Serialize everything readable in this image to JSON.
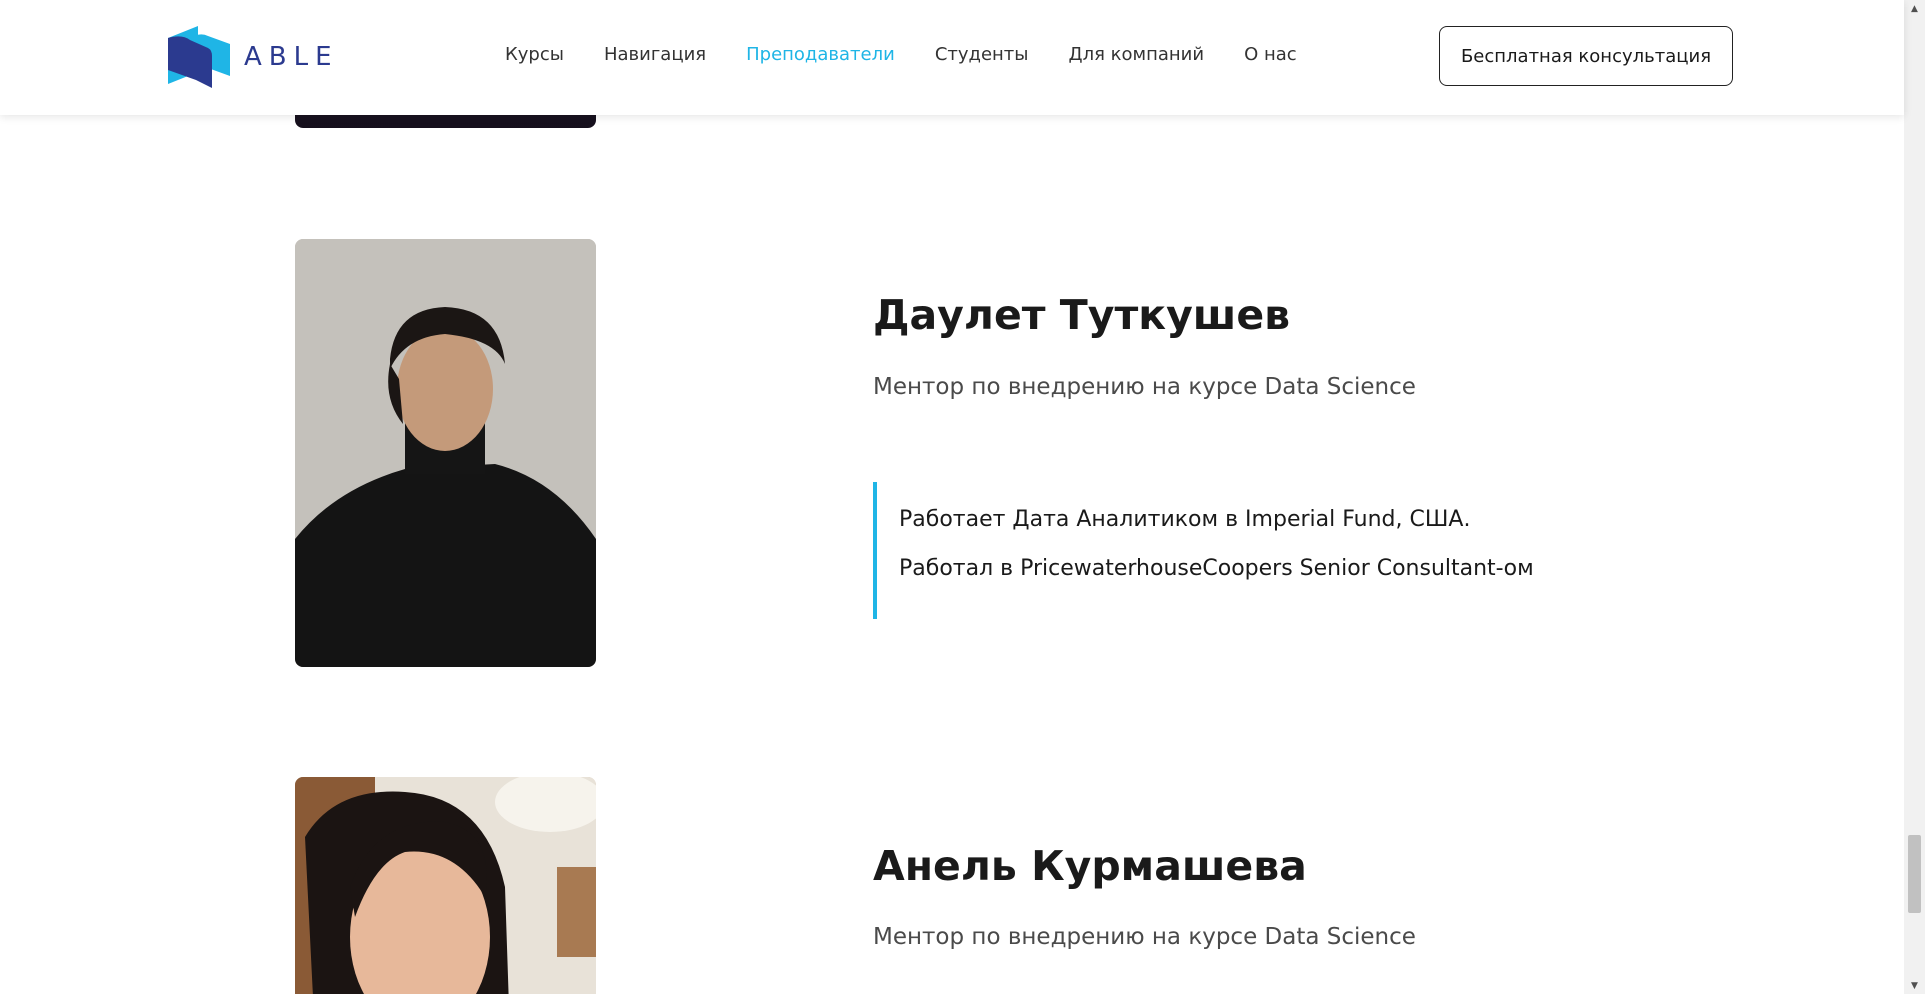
{
  "header": {
    "logo_text": "ABLE",
    "nav": [
      {
        "label": "Курсы",
        "active": false
      },
      {
        "label": "Навигация",
        "active": false
      },
      {
        "label": "Преподаватели",
        "active": true
      },
      {
        "label": "Студенты",
        "active": false
      },
      {
        "label": "Для компаний",
        "active": false
      },
      {
        "label": "О нас",
        "active": false
      }
    ],
    "cta_label": "Бесплатная консультация"
  },
  "teachers": [
    {
      "name": "Даулет Туткушев",
      "role": "Ментор по внедрению на курсе Data Science",
      "bio": [
        "Работает Дата Аналитиком в Imperial Fund, США.",
        "Работал в PricewaterhouseCoopers Senior Consultant-ом"
      ]
    },
    {
      "name": "Анель Курмашева",
      "role": "Ментор по внедрению на курсе Data Science"
    }
  ],
  "colors": {
    "accent": "#1fb5e6",
    "logo_dark": "#2b3a8f",
    "logo_light": "#1fb5e6",
    "text": "#1a1a1a"
  },
  "icons": {
    "scroll_up": "scroll-up-arrow-icon",
    "scroll_down": "scroll-down-arrow-icon"
  }
}
